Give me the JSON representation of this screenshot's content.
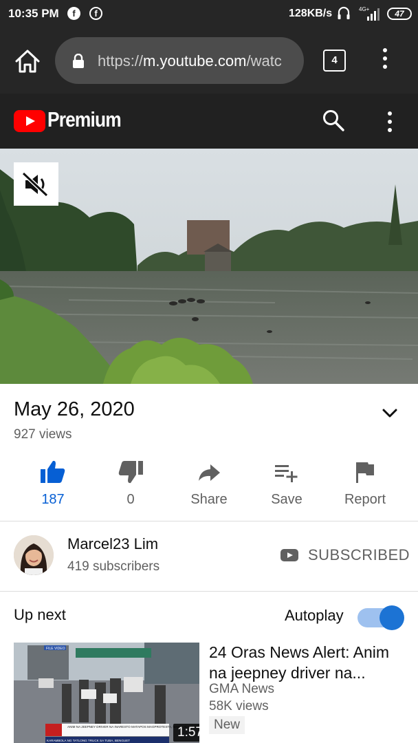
{
  "status_bar": {
    "time": "10:35 PM",
    "speed": "128KB/s",
    "network": "4G+",
    "battery": "47",
    "icons": [
      "facebook-icon",
      "facebook-messenger-icon",
      "headset-icon",
      "signal-icon",
      "battery-icon"
    ]
  },
  "browser": {
    "url_prefix": "https://",
    "url_host": "m.youtube.com",
    "url_rest": "/watc",
    "tab_count": "4"
  },
  "header": {
    "brand": "Premium"
  },
  "video": {
    "date": "May 26, 2020",
    "views": "927 views",
    "actions": [
      {
        "label": "187",
        "icon": "thumbs-up-icon"
      },
      {
        "label": "0",
        "icon": "thumbs-down-icon"
      },
      {
        "label": "Share",
        "icon": "share-icon"
      },
      {
        "label": "Save",
        "icon": "playlist-add-icon"
      },
      {
        "label": "Report",
        "icon": "flag-icon"
      }
    ]
  },
  "channel": {
    "name": "Marcel23 Lim",
    "subscribers": "419 subscribers",
    "subscribe_label": "SUBSCRIBED"
  },
  "up_next": {
    "heading": "Up next",
    "autoplay_label": "Autoplay",
    "autoplay_on": true,
    "items": [
      {
        "title": "24 Oras News Alert: Anim na jeepney driver na...",
        "channel": "GMA News",
        "views": "58K views",
        "badge": "New",
        "duration": "1:57",
        "thumb_headline": "ANIM NA JEEPNEY DRIVER NA INARESTO MATAPOS MAGPROTESTA, MAKALALAYA NA",
        "thumb_ticker": "KARAMBOLA NG TATLONG TRUCK SA TUBA, BENGUET",
        "thumb_tag": "FILE VIDEO"
      }
    ]
  },
  "colors": {
    "accent_blue": "#065fd4",
    "youtube_red": "#ff0000",
    "dark_bar": "#262626"
  }
}
